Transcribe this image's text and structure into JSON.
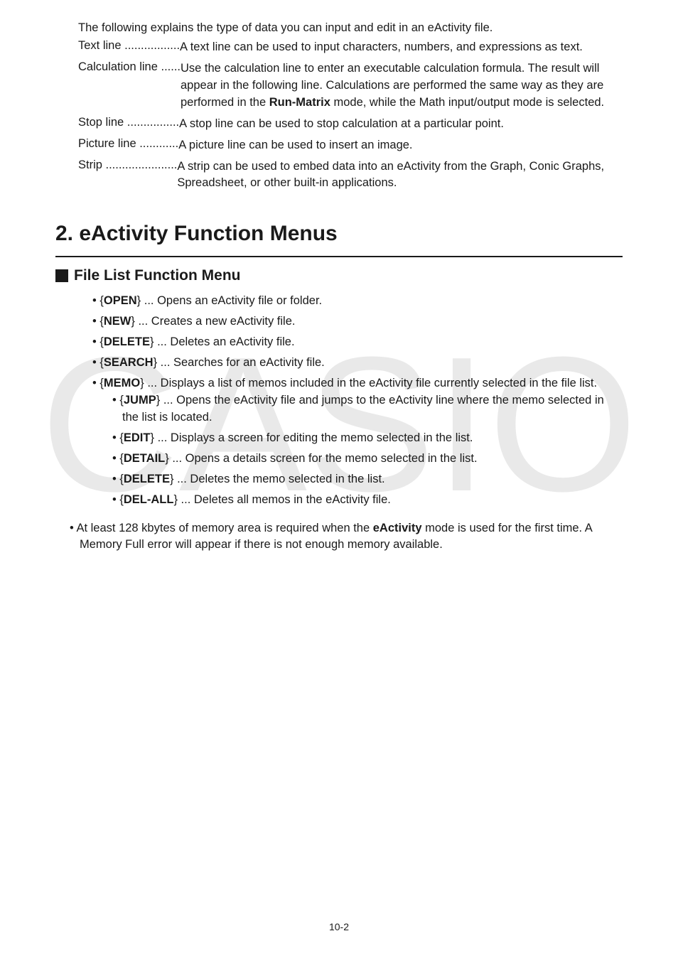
{
  "intro": "The following explains the type of data you can input and edit in an eActivity file.",
  "definitions": {
    "text": {
      "term_dots": "Text line .................",
      "desc": "A text line can be used to input characters, numbers, and expressions as text."
    },
    "calc": {
      "term_dots": "Calculation line ......",
      "desc_pre": "Use the calculation line to enter an executable calculation formula. The result will appear in the following line. Calculations are performed the same way as they are performed in the ",
      "bold": "Run-Matrix",
      "desc_post": " mode, while the Math input/output mode is selected."
    },
    "stop": {
      "term_dots": "Stop line ................",
      "desc": "A stop line can be used to stop calculation at a particular point."
    },
    "picture": {
      "term_dots": "Picture line ............",
      "desc": "A picture line can be used to insert an image."
    },
    "strip": {
      "term_dots": "Strip ......................",
      "desc": "A strip can be used to embed data into an eActivity from the Graph, Conic Graphs, Spreadsheet, or other built-in applications."
    }
  },
  "h1": "2. eActivity Function Menus",
  "h2": "File List Function Menu",
  "menu": {
    "open": {
      "label": "OPEN",
      "desc": " ... Opens an eActivity file or folder."
    },
    "new": {
      "label": "NEW",
      "desc": " ... Creates a new eActivity file."
    },
    "delete": {
      "label": "DELETE",
      "desc": " ... Deletes an eActivity file."
    },
    "search": {
      "label": "SEARCH",
      "desc": " ... Searches for an eActivity file."
    },
    "memo": {
      "label": "MEMO",
      "desc": " ... Displays a list of memos included in the eActivity file currently selected in the file list."
    },
    "sub": {
      "jump": {
        "label": "JUMP",
        "desc": " ... Opens the eActivity file and jumps to the eActivity line where the memo selected in the list is located."
      },
      "edit": {
        "label": "EDIT",
        "desc": " ... Displays a screen for editing the memo selected in the list."
      },
      "detail": {
        "label": "DETAIL",
        "desc": " ... Opens a details screen for the memo selected in the list."
      },
      "delete": {
        "label": "DELETE",
        "desc": " ... Deletes the memo selected in the list."
      },
      "delall": {
        "label": "DEL-ALL",
        "desc": " ... Deletes all memos in the eActivity file."
      }
    }
  },
  "note": {
    "pre": "At least 128 kbytes of memory area is required when the ",
    "bold": "eActivity",
    "post": " mode is used for the first time. A Memory Full error will appear if there is not enough memory available."
  },
  "footer": "10-2"
}
